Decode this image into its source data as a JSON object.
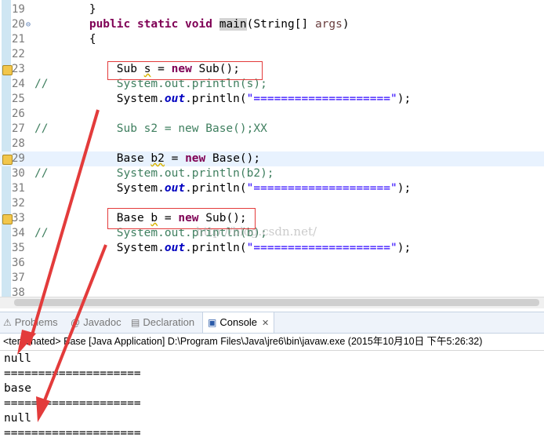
{
  "editor": {
    "lines": [
      {
        "n": "19",
        "html": "        }"
      },
      {
        "n": "20",
        "html": "        <span class=\"kw\">public static void</span> <span class=\"selword\">main</span>(String[] <span class=\"par\">args</span>)"
      },
      {
        "n": "21",
        "html": "        {"
      },
      {
        "n": "22",
        "html": ""
      },
      {
        "n": "23",
        "html": "            Sub <span class=\"sq\">s</span> = <span class=\"kw\">new</span> Sub();"
      },
      {
        "n": "24",
        "html": "<span class=\"cm\">//          System.out.println(s);</span>"
      },
      {
        "n": "25",
        "html": "            System.<span class=\"fld\">out</span>.println(<span class=\"st\">\"====================\"</span>);"
      },
      {
        "n": "26",
        "html": ""
      },
      {
        "n": "27",
        "html": "<span class=\"cm\">//          Sub s2 = new Base();XX</span>"
      },
      {
        "n": "28",
        "html": ""
      },
      {
        "n": "29",
        "html": "            Base <span class=\"sq\">b2</span> = <span class=\"kw\">new</span> Base();"
      },
      {
        "n": "30",
        "html": "<span class=\"cm\">//          System.out.println(b2);</span>"
      },
      {
        "n": "31",
        "html": "            System.<span class=\"fld\">out</span>.println(<span class=\"st\">\"====================\"</span>);"
      },
      {
        "n": "32",
        "html": ""
      },
      {
        "n": "33",
        "html": "            Base <span class=\"sq\">b</span> = <span class=\"kw\">new</span> Sub();"
      },
      {
        "n": "34",
        "html": "<span class=\"cm\">//          System.out.println(b);</span>"
      },
      {
        "n": "35",
        "html": "            System.<span class=\"fld\">out</span>.println(<span class=\"st\">\"====================\"</span>);"
      },
      {
        "n": "36",
        "html": ""
      },
      {
        "n": "37",
        "html": ""
      },
      {
        "n": "38",
        "html": ""
      }
    ],
    "watermark": "http://blog.csdn.net/"
  },
  "tabs": {
    "problems": "Problems",
    "javadoc": "Javadoc",
    "declaration": "Declaration",
    "console": "Console"
  },
  "console": {
    "status": "<terminated> Base [Java Application] D:\\Program Files\\Java\\jre6\\bin\\javaw.exe (2015年10月10日 下午5:26:32)",
    "output": [
      "null",
      "====================",
      "base",
      "====================",
      "null",
      "===================="
    ]
  },
  "colors": {
    "annotation_red": "#e33b3b",
    "keyword": "#7f0055",
    "comment": "#3f7f5f",
    "string": "#2a00ff"
  }
}
